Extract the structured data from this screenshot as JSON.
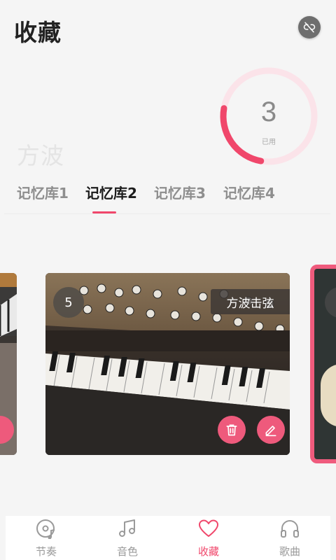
{
  "header": {
    "title": "收藏",
    "unlink_icon": "link-off-icon"
  },
  "usage": {
    "count": "3",
    "label": "已用",
    "fill_fraction": 0.25,
    "color": "#f0476b"
  },
  "current_tone": "方波",
  "tabs": [
    {
      "label": "记忆库1",
      "active": false
    },
    {
      "label": "记忆库2",
      "active": true
    },
    {
      "label": "记忆库3",
      "active": false
    },
    {
      "label": "记忆库4",
      "active": false
    }
  ],
  "cards": {
    "main": {
      "number": "5",
      "name": "方波击弦",
      "delete_icon": "trash-icon",
      "edit_icon": "pencil-icon"
    }
  },
  "bottom_nav": [
    {
      "label": "节奏",
      "icon": "disc-music-icon",
      "active": false
    },
    {
      "label": "音色",
      "icon": "music-note-icon",
      "active": false
    },
    {
      "label": "收藏",
      "icon": "heart-icon",
      "active": true
    },
    {
      "label": "歌曲",
      "icon": "headphones-icon",
      "active": false
    }
  ],
  "accent_color": "#f0476b"
}
